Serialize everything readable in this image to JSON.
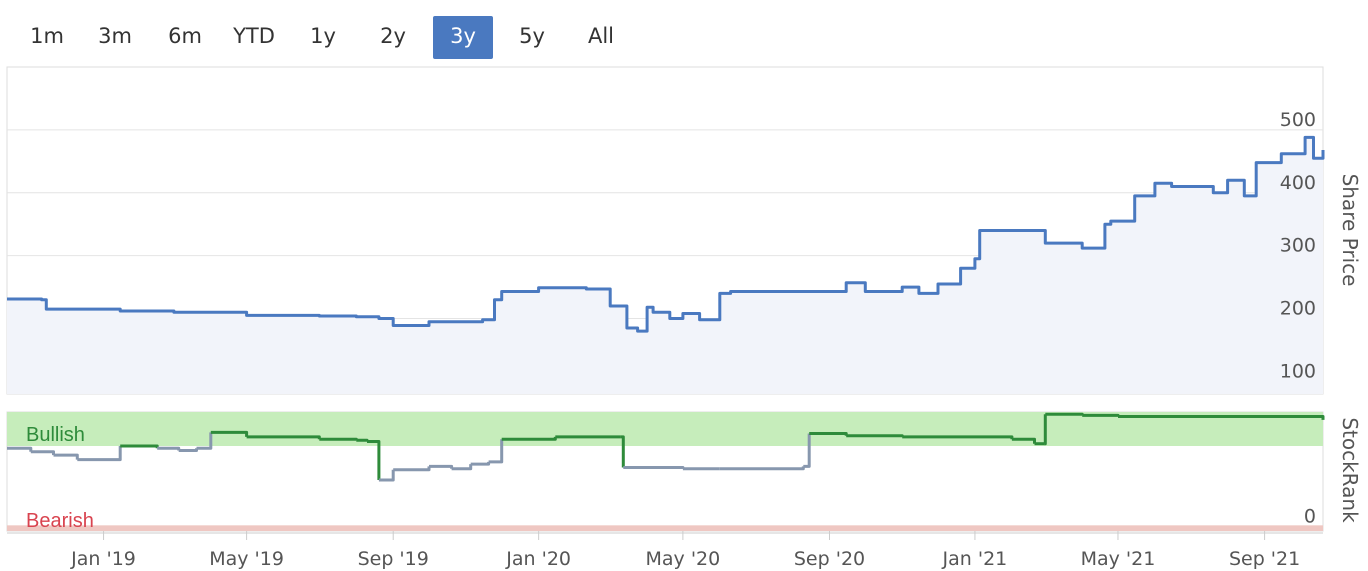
{
  "range_selector": {
    "buttons": [
      {
        "label": "1m"
      },
      {
        "label": "3m"
      },
      {
        "label": "6m"
      },
      {
        "label": "YTD"
      },
      {
        "label": "1y"
      },
      {
        "label": "2y"
      },
      {
        "label": "3y"
      },
      {
        "label": "5y"
      },
      {
        "label": "All"
      }
    ],
    "selected": "3y"
  },
  "colors": {
    "price_line": "#4a79c0",
    "price_fill": "#f2f4fa",
    "bullish_zone": "#c6edbb",
    "bearish_zone": "#efc7c2",
    "bullish_line": "#2e8b3a",
    "neutral_line": "#8797ae",
    "bullish_text": "#2e8b3a",
    "bearish_text": "#d9434f",
    "active_button": "#4a79c0"
  },
  "chart_data": [
    {
      "type": "line",
      "name": "share-price",
      "ylabel": "Share Price",
      "yticks": [
        100,
        200,
        300,
        400,
        500
      ],
      "ylim": [
        80,
        600
      ],
      "xlim": [
        "2018-10-12",
        "2021-10-20"
      ],
      "grid": true,
      "x": [
        "2018-10-12",
        "2018-11-10",
        "2018-11-14",
        "2018-12-01",
        "2019-01-15",
        "2019-03-01",
        "2019-05-01",
        "2019-07-01",
        "2019-08-01",
        "2019-08-20",
        "2019-09-01",
        "2019-10-01",
        "2019-11-15",
        "2019-11-25",
        "2019-12-01",
        "2020-01-01",
        "2020-02-10",
        "2020-03-01",
        "2020-03-15",
        "2020-03-24",
        "2020-04-01",
        "2020-04-06",
        "2020-04-20",
        "2020-05-01",
        "2020-05-15",
        "2020-06-01",
        "2020-06-10",
        "2020-07-01",
        "2020-08-15",
        "2020-09-15",
        "2020-10-01",
        "2020-11-01",
        "2020-11-15",
        "2020-12-01",
        "2020-12-20",
        "2021-01-01",
        "2021-01-05",
        "2021-03-01",
        "2021-04-01",
        "2021-04-20",
        "2021-04-25",
        "2021-05-15",
        "2021-06-01",
        "2021-06-15",
        "2021-07-20",
        "2021-08-01",
        "2021-08-15",
        "2021-08-25",
        "2021-09-05",
        "2021-09-15",
        "2021-10-05",
        "2021-10-12",
        "2021-10-20"
      ],
      "values": [
        231,
        230,
        215,
        215,
        212,
        210,
        205,
        204,
        203,
        200,
        189,
        195,
        198,
        230,
        243,
        249,
        247,
        220,
        185,
        180,
        218,
        210,
        200,
        208,
        198,
        240,
        243,
        243,
        243,
        257,
        243,
        250,
        240,
        255,
        280,
        295,
        340,
        320,
        312,
        350,
        355,
        395,
        415,
        410,
        400,
        420,
        395,
        448,
        448,
        462,
        488,
        455,
        468
      ]
    },
    {
      "type": "line",
      "name": "stockrank",
      "ylabel": "StockRank",
      "yticks": [
        0
      ],
      "ylim": [
        -5,
        100
      ],
      "bands": [
        {
          "label": "Bullish",
          "from": 70,
          "to": 100
        },
        {
          "label": "Bearish",
          "from": -5,
          "to": 0
        }
      ],
      "x": [
        "2018-10-12",
        "2018-11-01",
        "2018-11-20",
        "2018-12-10",
        "2019-01-15",
        "2019-02-15",
        "2019-03-05",
        "2019-03-20",
        "2019-04-01",
        "2019-05-01",
        "2019-07-01",
        "2019-08-01",
        "2019-08-10",
        "2019-08-20",
        "2019-09-01",
        "2019-10-01",
        "2019-10-20",
        "2019-11-05",
        "2019-11-20",
        "2019-12-01",
        "2020-01-15",
        "2020-03-10",
        "2020-03-12",
        "2020-05-01",
        "2020-06-01",
        "2020-08-10",
        "2020-08-15",
        "2020-09-15",
        "2020-11-01",
        "2020-12-01",
        "2021-02-01",
        "2021-02-20",
        "2021-02-28",
        "2021-03-01",
        "2021-04-01",
        "2021-05-01",
        "2021-10-20"
      ],
      "values": [
        68,
        65,
        62,
        58,
        70,
        68,
        66,
        68,
        82,
        78,
        76,
        75,
        74,
        40,
        49,
        52,
        50,
        54,
        56,
        76,
        78,
        78,
        51,
        50,
        50,
        52,
        81,
        79,
        78,
        78,
        76,
        72,
        72,
        98,
        97,
        96,
        93
      ]
    }
  ],
  "x_axis": {
    "ticks": [
      {
        "label": "Jan '19",
        "date": "2019-01-01"
      },
      {
        "label": "May '19",
        "date": "2019-05-01"
      },
      {
        "label": "Sep '19",
        "date": "2019-09-01"
      },
      {
        "label": "Jan '20",
        "date": "2020-01-01"
      },
      {
        "label": "May '20",
        "date": "2020-05-01"
      },
      {
        "label": "Sep '20",
        "date": "2020-09-01"
      },
      {
        "label": "Jan '21",
        "date": "2021-01-01"
      },
      {
        "label": "May '21",
        "date": "2021-05-01"
      },
      {
        "label": "Sep '21",
        "date": "2021-09-01"
      }
    ]
  }
}
